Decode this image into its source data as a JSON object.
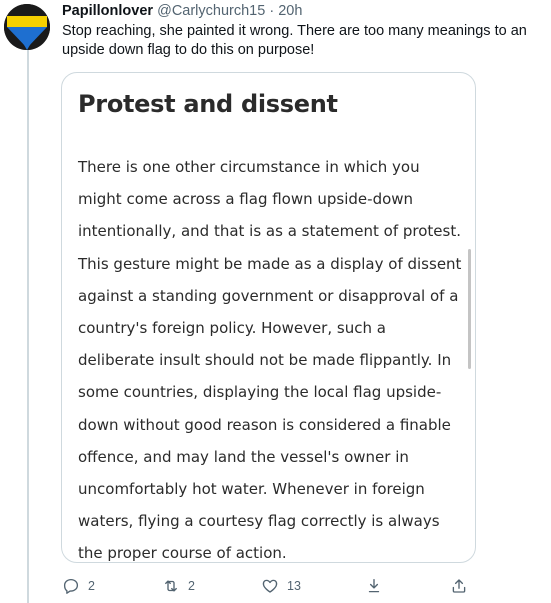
{
  "tweet": {
    "author": {
      "name": "Papillonlover",
      "handle": "@Carlychurch15",
      "separator": "·",
      "time": "20h"
    },
    "text": "Stop reaching, she painted it wrong. There are too many meanings to an upside down flag to do this on purpose!",
    "card": {
      "title": "Protest and dissent",
      "body": "There is one other circumstance in which you might come across a flag flown upside-down intentionally, and that is as a statement of protest. This gesture might be made as a display of dissent against a standing government or disapproval of a country's foreign policy. However, such a deliberate insult should not be made flippantly. In some countries, displaying the local flag upside-down without good reason is considered a finable offence, and may land the vessel's owner in uncomfortably hot water. Whenever in foreign waters, flying a courtesy flag correctly is always the proper course of action."
    },
    "actions": {
      "reply": {
        "icon": "reply-icon",
        "count": "2"
      },
      "retweet": {
        "icon": "retweet-icon",
        "count": "2"
      },
      "like": {
        "icon": "heart-icon",
        "count": "13"
      },
      "download": {
        "icon": "download-icon"
      },
      "share": {
        "icon": "share-icon"
      }
    },
    "colors": {
      "avatar_top": "#f5d000",
      "avatar_bottom": "#1e6fd0",
      "secondary_text": "#536471",
      "border": "#cfd9de"
    }
  }
}
